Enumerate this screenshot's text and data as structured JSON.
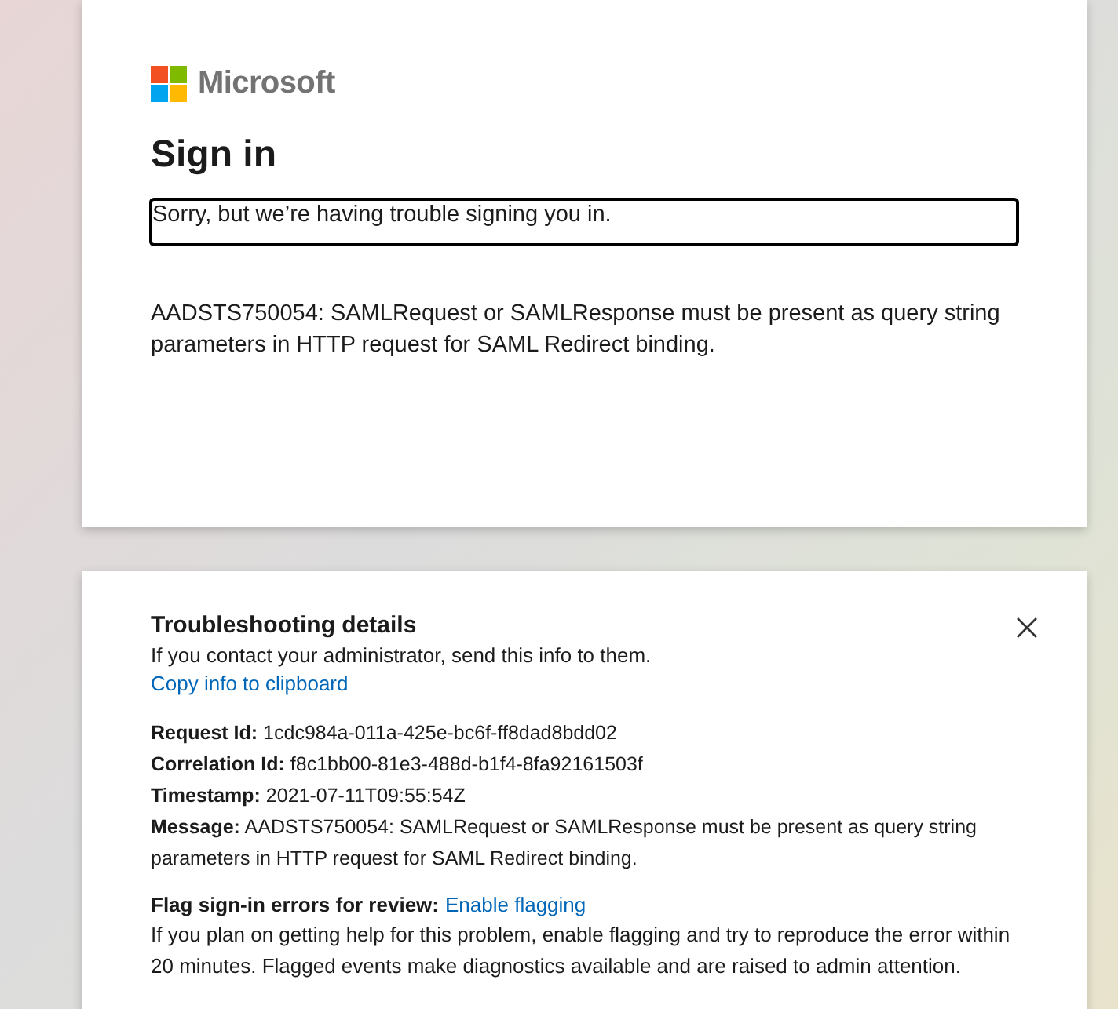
{
  "sign_in_card": {
    "brand": "Microsoft",
    "title": "Sign in",
    "notice": "Sorry, but we’re having trouble signing you in.",
    "error": "AADSTS750054: SAMLRequest or SAMLResponse must be present as query string parameters in HTTP request for SAML Redirect binding."
  },
  "troubleshooting": {
    "title": "Troubleshooting details",
    "subtitle": "If you contact your administrator, send this info to them.",
    "copy_link": "Copy info to clipboard",
    "details": [
      {
        "label": "Request Id:",
        "value": "1cdc984a-011a-425e-bc6f-ff8dad8bdd02"
      },
      {
        "label": "Correlation Id:",
        "value": "f8c1bb00-81e3-488d-b1f4-8fa92161503f"
      },
      {
        "label": "Timestamp:",
        "value": "2021-07-11T09:55:54Z"
      },
      {
        "label": "Message:",
        "value": "AADSTS750054: SAMLRequest or SAMLResponse must be present as query string parameters in HTTP request for SAML Redirect binding."
      }
    ],
    "flag_label": "Flag sign-in errors for review:",
    "flag_link": "Enable flagging",
    "flag_text": "If you plan on getting help for this problem, enable flagging and try to reproduce the error within 20 minutes. Flagged events make diagnostics available and are raised to admin attention."
  }
}
